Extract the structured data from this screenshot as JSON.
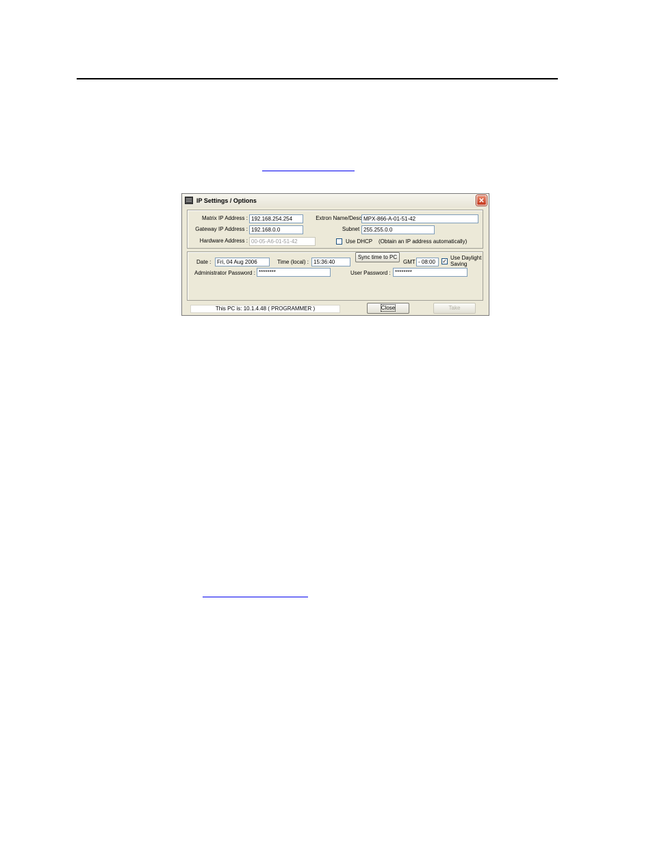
{
  "dialog": {
    "title": "IP Settings / Options",
    "close_glyph": "✕",
    "network": {
      "matrix_ip_label": "Matrix IP Address :",
      "matrix_ip_value": "192.168.254.254",
      "gateway_ip_label": "Gateway IP Address :",
      "gateway_ip_value": "192.168.0.0",
      "hardware_label": "Hardware Address :",
      "hardware_value": "00-05-A6-01-51-42",
      "name_label": "Extron Name/Descriptor :",
      "name_value": "MPX-866-A-01-51-42",
      "subnet_label": "Subnet Mask :",
      "subnet_value": "255.255.0.0",
      "dhcp_label": "Use DHCP",
      "dhcp_checked": false,
      "dhcp_note": "(Obtain an IP address automatically)"
    },
    "time": {
      "date_label": "Date :",
      "date_value": "Fri, 04 Aug 2006",
      "time_label": "Time (local) :",
      "time_value": "15:36:40",
      "sync_button": "Sync time to PC",
      "gmt_label": "GMT",
      "gmt_value": "- 08:00",
      "daylight_checked": true,
      "daylight_check_glyph": "✓",
      "daylight_label_1": "Use Daylight",
      "daylight_label_2": "Saving",
      "admin_pw_label": "Administrator Password :",
      "admin_pw_value": "********",
      "user_pw_label": "User Password :",
      "user_pw_value": "********"
    },
    "footer": {
      "status": "This PC is:   10.1.4.48   ( PROGRAMMER )",
      "close_button": "Close",
      "take_button": "Take"
    }
  },
  "colors": {
    "dialog_bg": "#ece9d8",
    "input_border": "#7f9db9",
    "close_red": "#c4371c",
    "link_blue": "#0000ee"
  }
}
